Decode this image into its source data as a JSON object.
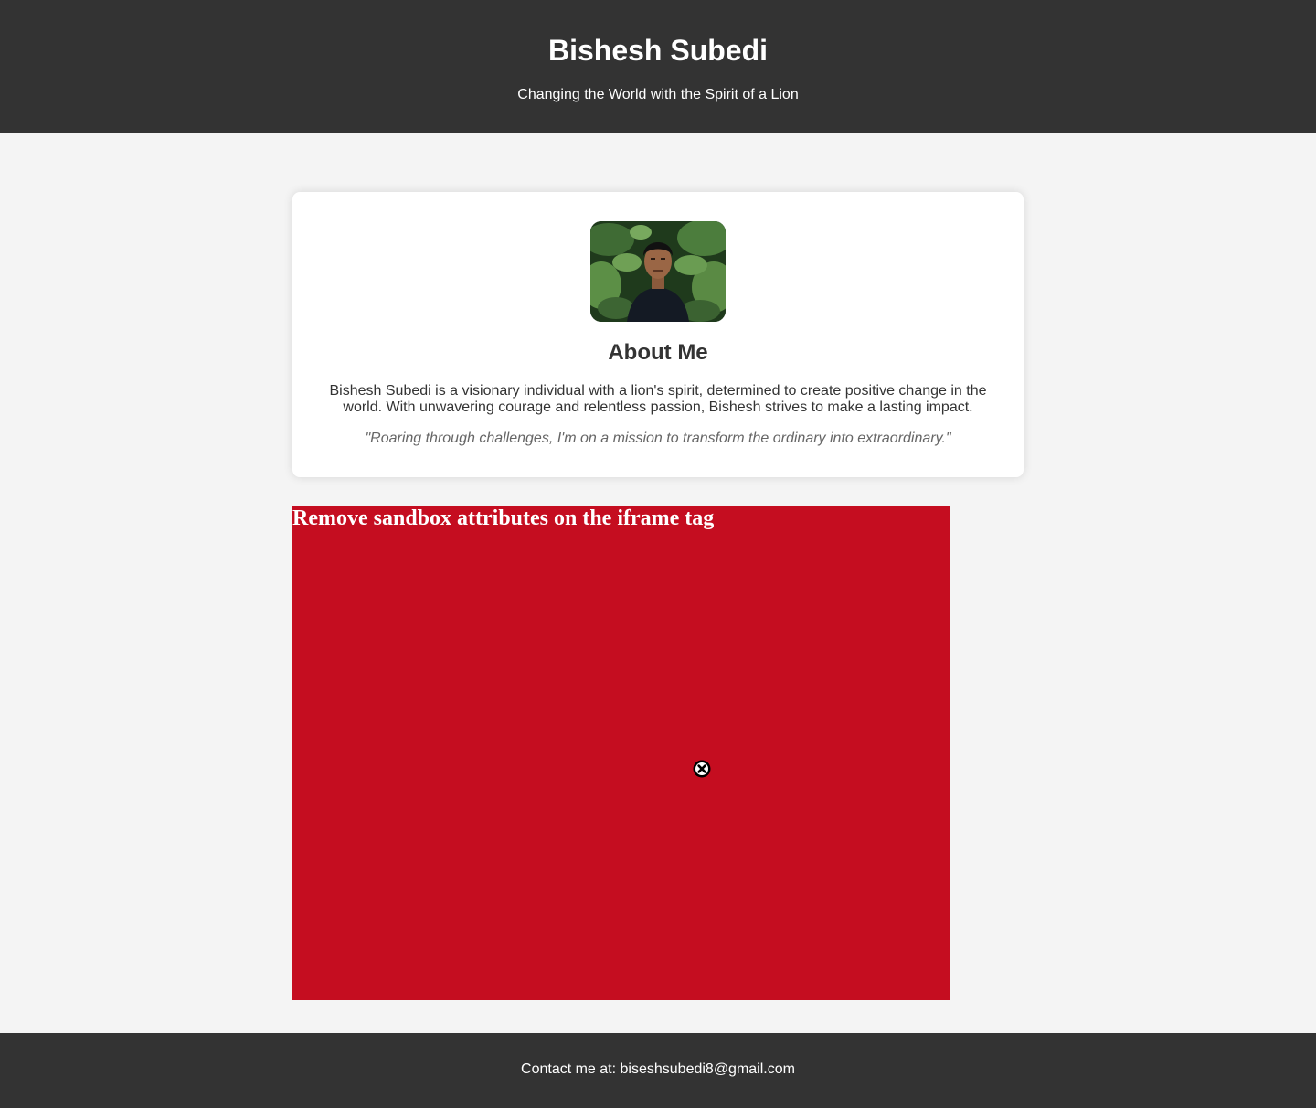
{
  "header": {
    "title": "Bishesh Subedi",
    "tagline": "Changing the World with the Spirit of a Lion"
  },
  "about": {
    "heading": "About Me",
    "bio": "Bishesh Subedi is a visionary individual with a lion's spirit, determined to create positive change in the world. With unwavering courage and relentless passion, Bishesh strives to make a lasting impact.",
    "quote": "\"Roaring through challenges, I'm on a mission to transform the ordinary into extraordinary.\""
  },
  "embed": {
    "message": "Remove sandbox attributes on the iframe tag",
    "background_color": "#c50d20",
    "icon": "close-circle-icon"
  },
  "footer": {
    "contact_label": "Contact me at:",
    "email": "biseshsubedi8@gmail.com"
  },
  "colors": {
    "header_bg": "#333333",
    "page_bg": "#f4f4f4",
    "card_bg": "#ffffff"
  }
}
